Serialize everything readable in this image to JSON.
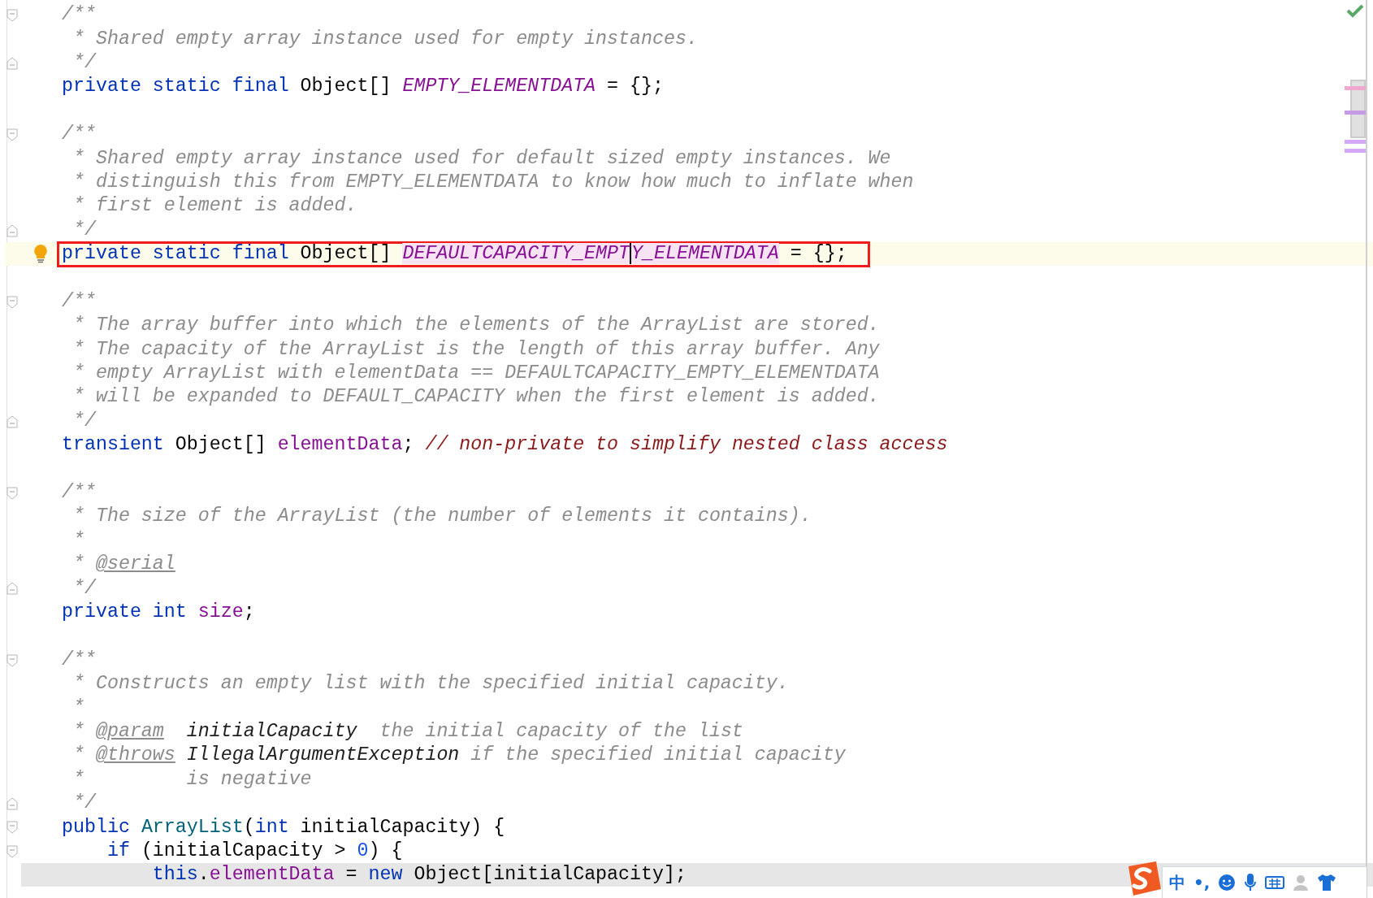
{
  "editor": {
    "lines": [
      {
        "kind": "code",
        "fold_start": true,
        "tokens": [
          {
            "kind": "comment",
            "text": "/**"
          }
        ]
      },
      {
        "kind": "code",
        "tokens": [
          {
            "kind": "comment",
            "text": " * Shared empty array instance used for empty instances."
          }
        ]
      },
      {
        "kind": "code",
        "fold_end": true,
        "tokens": [
          {
            "kind": "comment",
            "text": " */"
          }
        ]
      },
      {
        "kind": "code",
        "tokens": [
          {
            "kind": "keyword",
            "text": "private static final "
          },
          {
            "kind": "plain",
            "text": "Object[] "
          },
          {
            "kind": "static-field",
            "text": "EMPTY_ELEMENTDATA"
          },
          {
            "kind": "plain",
            "text": " = {};"
          }
        ]
      },
      {
        "kind": "blank"
      },
      {
        "kind": "code",
        "fold_start": true,
        "tokens": [
          {
            "kind": "comment",
            "text": "/**"
          }
        ]
      },
      {
        "kind": "code",
        "tokens": [
          {
            "kind": "comment",
            "text": " * Shared empty array instance used for default sized empty instances. We"
          }
        ]
      },
      {
        "kind": "code",
        "tokens": [
          {
            "kind": "comment",
            "text": " * distinguish this from EMPTY_ELEMENTDATA to know how much to inflate when"
          }
        ]
      },
      {
        "kind": "code",
        "tokens": [
          {
            "kind": "comment",
            "text": " * first element is added."
          }
        ]
      },
      {
        "kind": "code",
        "fold_end": true,
        "tokens": [
          {
            "kind": "comment",
            "text": " */"
          }
        ]
      },
      {
        "kind": "code",
        "current": true,
        "boxed": true,
        "bulb": true,
        "tokens": [
          {
            "kind": "keyword",
            "text": "private static final "
          },
          {
            "kind": "plain",
            "text": "Object[] "
          },
          {
            "kind": "static-field",
            "text": "DEFAULTCAPACITY_EMPT",
            "highlighted": true,
            "caret": true
          },
          {
            "kind": "static-field",
            "text": "Y_ELEMENTDATA",
            "highlighted": true
          },
          {
            "kind": "plain",
            "text": " = {};"
          }
        ]
      },
      {
        "kind": "blank"
      },
      {
        "kind": "code",
        "fold_start": true,
        "tokens": [
          {
            "kind": "comment",
            "text": "/**"
          }
        ]
      },
      {
        "kind": "code",
        "tokens": [
          {
            "kind": "comment",
            "text": " * The array buffer into which the elements of the ArrayList are stored."
          }
        ]
      },
      {
        "kind": "code",
        "tokens": [
          {
            "kind": "comment",
            "text": " * The capacity of the ArrayList is the length of this array buffer. Any"
          }
        ]
      },
      {
        "kind": "code",
        "tokens": [
          {
            "kind": "comment",
            "text": " * empty ArrayList with elementData == DEFAULTCAPACITY_EMPTY_ELEMENTDATA"
          }
        ]
      },
      {
        "kind": "code",
        "tokens": [
          {
            "kind": "comment",
            "text": " * will be expanded to DEFAULT_CAPACITY when the first element is added."
          }
        ]
      },
      {
        "kind": "code",
        "fold_end": true,
        "tokens": [
          {
            "kind": "comment",
            "text": " */"
          }
        ]
      },
      {
        "kind": "code",
        "tokens": [
          {
            "kind": "keyword",
            "text": "transient "
          },
          {
            "kind": "plain",
            "text": "Object[] "
          },
          {
            "kind": "field",
            "text": "elementData"
          },
          {
            "kind": "plain",
            "text": "; "
          },
          {
            "kind": "line-comment",
            "text": "// non-private to simplify nested class access"
          }
        ]
      },
      {
        "kind": "blank"
      },
      {
        "kind": "code",
        "fold_start": true,
        "tokens": [
          {
            "kind": "comment",
            "text": "/**"
          }
        ]
      },
      {
        "kind": "code",
        "tokens": [
          {
            "kind": "comment",
            "text": " * The size of the ArrayList (the number of elements it contains)."
          }
        ]
      },
      {
        "kind": "code",
        "tokens": [
          {
            "kind": "comment",
            "text": " *"
          }
        ]
      },
      {
        "kind": "code",
        "tokens": [
          {
            "kind": "comment",
            "text": " * "
          },
          {
            "kind": "doc-tag",
            "text": "@serial"
          }
        ]
      },
      {
        "kind": "code",
        "fold_end": true,
        "tokens": [
          {
            "kind": "comment",
            "text": " */"
          }
        ]
      },
      {
        "kind": "code",
        "tokens": [
          {
            "kind": "keyword",
            "text": "private int "
          },
          {
            "kind": "field",
            "text": "size"
          },
          {
            "kind": "plain",
            "text": ";"
          }
        ]
      },
      {
        "kind": "blank"
      },
      {
        "kind": "code",
        "fold_start": true,
        "tokens": [
          {
            "kind": "comment",
            "text": "/**"
          }
        ]
      },
      {
        "kind": "code",
        "tokens": [
          {
            "kind": "comment",
            "text": " * Constructs an empty list with the specified initial capacity."
          }
        ]
      },
      {
        "kind": "code",
        "tokens": [
          {
            "kind": "comment",
            "text": " *"
          }
        ]
      },
      {
        "kind": "code",
        "tokens": [
          {
            "kind": "comment",
            "text": " * "
          },
          {
            "kind": "doc-tag",
            "text": "@param"
          },
          {
            "kind": "doc-ref",
            "text": "  initialCapacity"
          },
          {
            "kind": "comment",
            "text": "  the initial capacity of the list"
          }
        ]
      },
      {
        "kind": "code",
        "tokens": [
          {
            "kind": "comment",
            "text": " * "
          },
          {
            "kind": "doc-tag",
            "text": "@throws"
          },
          {
            "kind": "doc-ref",
            "text": " IllegalArgumentException"
          },
          {
            "kind": "comment",
            "text": " if the specified initial capacity"
          }
        ]
      },
      {
        "kind": "code",
        "tokens": [
          {
            "kind": "comment",
            "text": " *         is negative"
          }
        ]
      },
      {
        "kind": "code",
        "fold_end": true,
        "tokens": [
          {
            "kind": "comment",
            "text": " */"
          }
        ]
      },
      {
        "kind": "code",
        "fold_start": true,
        "tokens": [
          {
            "kind": "keyword",
            "text": "public "
          },
          {
            "kind": "declaration",
            "text": "ArrayList"
          },
          {
            "kind": "plain",
            "text": "("
          },
          {
            "kind": "keyword",
            "text": "int "
          },
          {
            "kind": "plain",
            "text": "initialCapacity) {"
          }
        ]
      },
      {
        "kind": "code",
        "fold_start": true,
        "tokens": [
          {
            "kind": "keyword",
            "text": "    if "
          },
          {
            "kind": "plain",
            "text": "(initialCapacity > "
          },
          {
            "kind": "number",
            "text": "0"
          },
          {
            "kind": "plain",
            "text": ") {"
          }
        ]
      },
      {
        "kind": "code",
        "shaded": true,
        "tokens": [
          {
            "kind": "keyword",
            "text": "        this"
          },
          {
            "kind": "plain",
            "text": "."
          },
          {
            "kind": "field",
            "text": "elementData"
          },
          {
            "kind": "plain",
            "text": " = "
          },
          {
            "kind": "keyword",
            "text": "new "
          },
          {
            "kind": "plain",
            "text": "Object[initialCapacity];"
          }
        ]
      }
    ]
  },
  "ime_toolbar": {
    "language": "中",
    "punctuation": "•,"
  }
}
